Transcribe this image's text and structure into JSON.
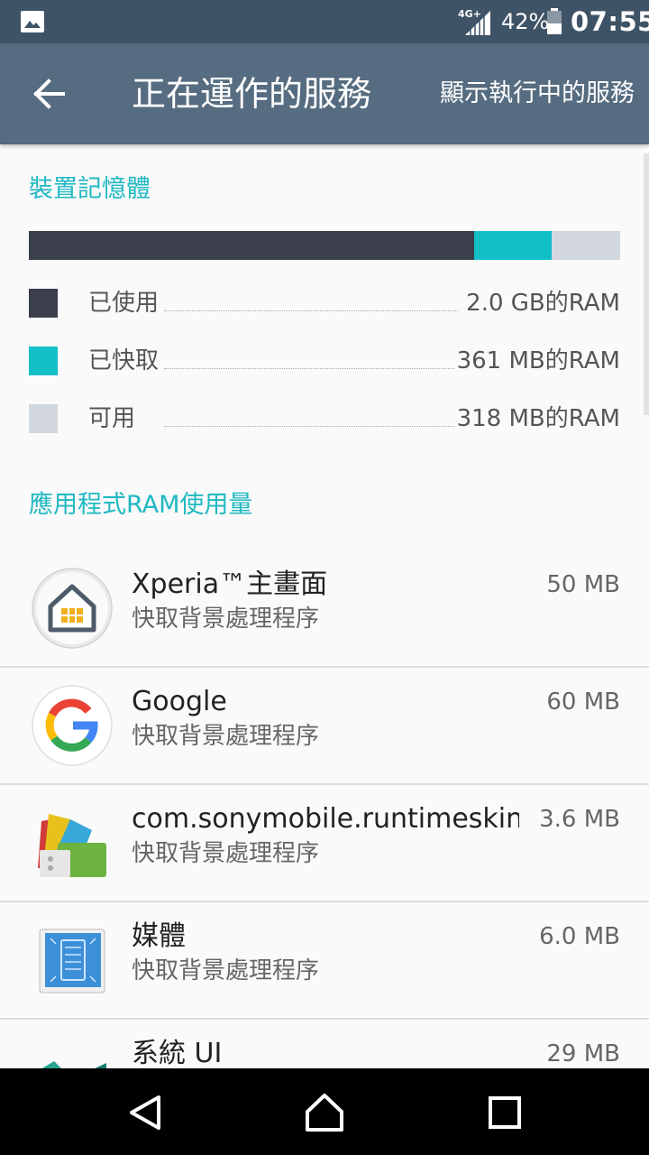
{
  "status_bar": {
    "network": "4G+",
    "battery_percent": "42%",
    "time": "07:55"
  },
  "app_bar": {
    "title": "正在運作的服務",
    "action_label": "顯示執行中的服務"
  },
  "memory": {
    "header": "裝置記憶體",
    "bar": [
      {
        "key": "used",
        "fraction": 0.753,
        "color": "#3a3f4b"
      },
      {
        "key": "cached",
        "fraction": 0.131,
        "color": "#13bfc7"
      },
      {
        "key": "free",
        "fraction": 0.116,
        "color": "#d1d7dd"
      }
    ],
    "legend": [
      {
        "label": "已使用",
        "value": "2.0 GB的RAM",
        "color": "#3a3f4b"
      },
      {
        "label": "已快取",
        "value": "361 MB的RAM",
        "color": "#13bfc7"
      },
      {
        "label": "可用",
        "value": "318 MB的RAM",
        "color": "#d1d7dd"
      }
    ]
  },
  "app_usage": {
    "header": "應用程式RAM使用量",
    "items": [
      {
        "name": "Xperia™主畫面",
        "status": "快取背景處理程序",
        "size": "50 MB",
        "icon": "xperia-home-icon"
      },
      {
        "name": "Google",
        "status": "快取背景處理程序",
        "size": "60 MB",
        "icon": "google-icon"
      },
      {
        "name": "com.sonymobile.runtimeskin..",
        "status": "快取背景處理程序",
        "size": "3.6 MB",
        "icon": "runtime-skin-icon"
      },
      {
        "name": "媒體",
        "status": "快取背景處理程序",
        "size": "6.0 MB",
        "icon": "media-blueprint-icon"
      },
      {
        "name": "系統 UI",
        "status": "",
        "size": "29 MB",
        "icon": "system-ui-icon"
      }
    ]
  },
  "colors": {
    "status_bar": "#3e5366",
    "app_bar": "#566c80",
    "accent": "#1fb8c2"
  }
}
